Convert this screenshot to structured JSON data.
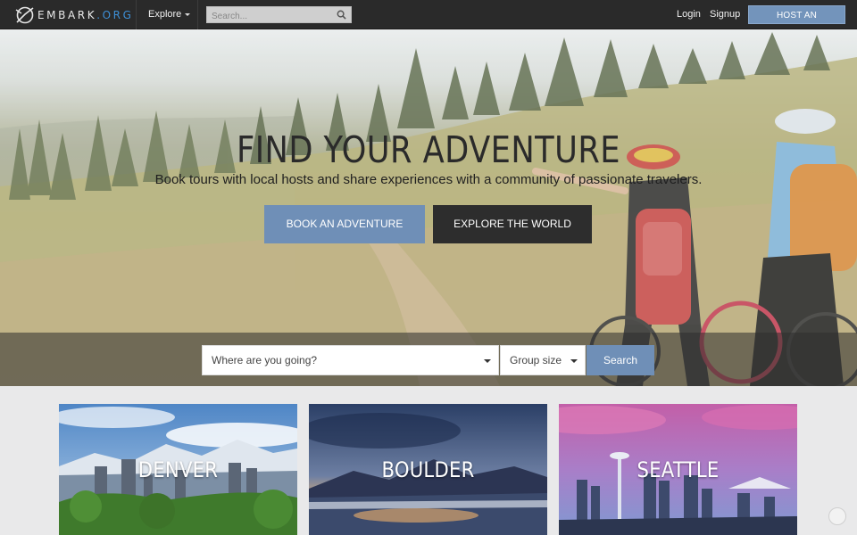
{
  "navbar": {
    "logo": {
      "name": "EMBARK",
      "suffix": ".ORG",
      "icon": "compass-logo-icon"
    },
    "explore_label": "Explore",
    "search_placeholder": "Search...",
    "login_label": "Login",
    "signup_label": "Signup",
    "host_label": "HOST AN ADVENTURE"
  },
  "hero": {
    "title": "FIND YOUR ADVENTURE",
    "subtitle": "Book tours with local hosts and share experiences with a community of passionate travelers.",
    "book_label": "BOOK AN ADVENTURE",
    "explore_label": "EXPLORE THE WORLD"
  },
  "search_form": {
    "destination_placeholder": "Where are you going?",
    "group_size_label": "Group size",
    "submit_label": "Search"
  },
  "cities": [
    {
      "name": "DENVER"
    },
    {
      "name": "BOULDER"
    },
    {
      "name": "SEATTLE"
    }
  ],
  "colors": {
    "navbar_bg": "#2a2a2a",
    "accent": "#6f8fb7",
    "dark_button": "#2d2d2d",
    "page_bg": "#e9e9ea",
    "logo_org": "#3d8fd6"
  }
}
